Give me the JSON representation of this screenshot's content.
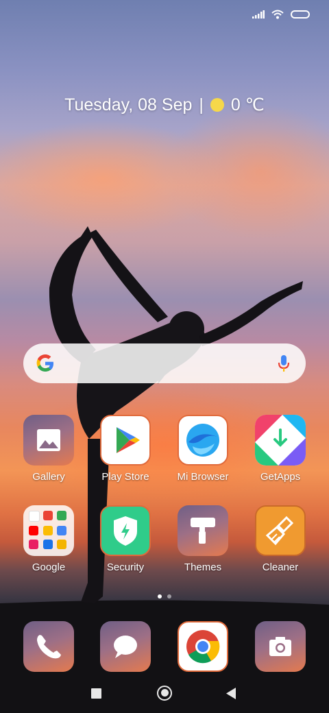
{
  "status_bar": {
    "icons": [
      "signal-icon",
      "wifi-icon",
      "battery-icon"
    ]
  },
  "date_widget": {
    "date": "Tuesday, 08 Sep",
    "separator": "|",
    "temperature": "0 ℃",
    "weather_icon": "sunny-icon"
  },
  "search_bar": {
    "logo": "google-logo-icon",
    "mic": "microphone-icon"
  },
  "apps_row1": [
    {
      "label": "Gallery",
      "icon": "gallery-icon"
    },
    {
      "label": "Play Store",
      "icon": "play-store-icon"
    },
    {
      "label": "Mi Browser",
      "icon": "mi-browser-icon"
    },
    {
      "label": "GetApps",
      "icon": "getapps-icon"
    }
  ],
  "apps_row2": [
    {
      "label": "Google",
      "icon": "google-folder-icon"
    },
    {
      "label": "Security",
      "icon": "security-icon"
    },
    {
      "label": "Themes",
      "icon": "themes-icon"
    },
    {
      "label": "Cleaner",
      "icon": "cleaner-icon"
    }
  ],
  "page_indicator": {
    "pages": 2,
    "current": 1
  },
  "dock": [
    {
      "icon": "phone-icon"
    },
    {
      "icon": "messages-icon"
    },
    {
      "icon": "chrome-icon"
    },
    {
      "icon": "camera-icon"
    }
  ],
  "nav_bar": {
    "buttons": [
      "recents-button",
      "home-button",
      "back-button"
    ]
  },
  "colors": {
    "accent_orange": "#e47a4f",
    "security_green": "#2fcc8a",
    "cleaner_orange": "#f09a30"
  }
}
